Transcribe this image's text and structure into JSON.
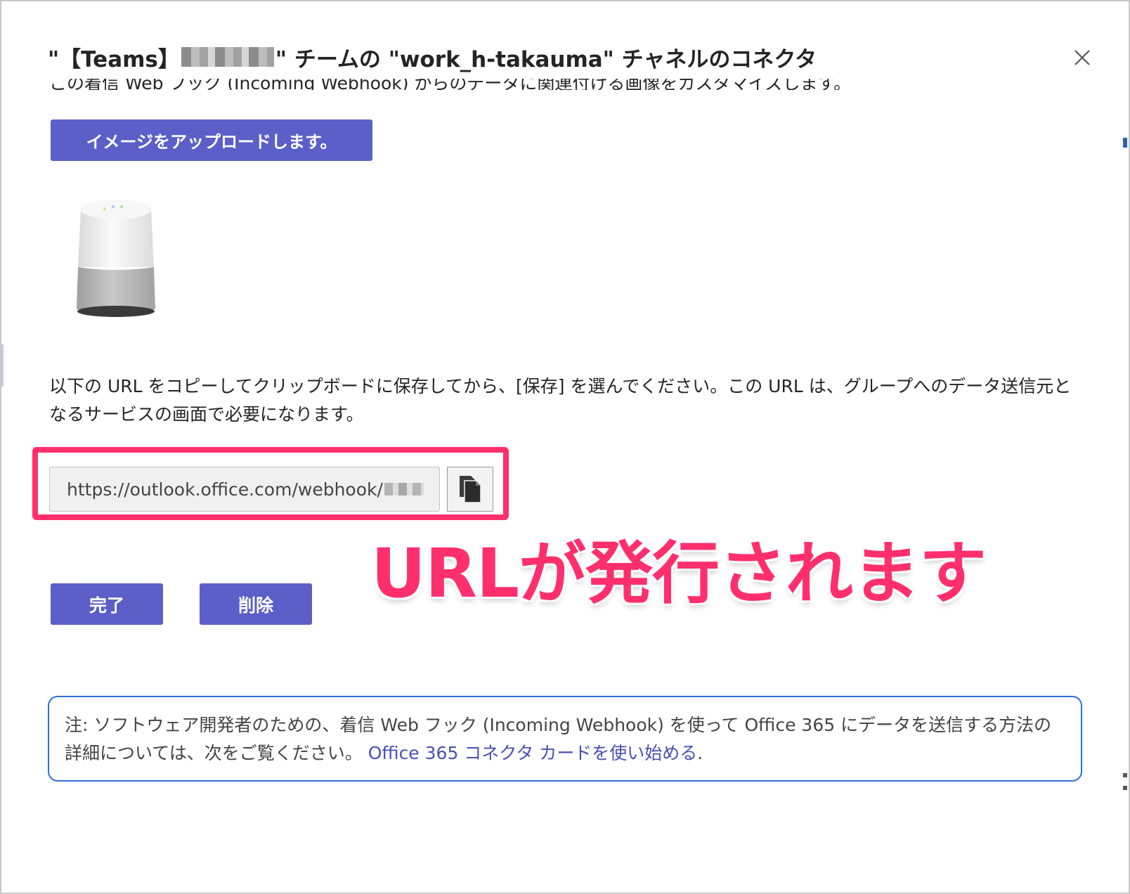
{
  "dialog": {
    "title_prefix": "\"【Teams】",
    "title_suffix": "\" チームの \"work_h-takauma\" チャネルのコネクタ",
    "close_icon": "close-icon",
    "partially_hidden_text": "この着信 Web フック (Incoming Webhook) からのデータに関連付ける画像をカスタマイズします。",
    "upload_button": "イメージをアップロードします。",
    "instruction": "以下の URL をコピーしてクリップボードに保存してから、[保存] を選んでください。この URL は、グループへのデータ送信元となるサービスの画面で必要になります。",
    "url_value": "https://outlook.office.com/webhook/",
    "copy_icon": "copy-icon",
    "done_button": "完了",
    "delete_button": "削除",
    "note_text": "注: ソフトウェア開発者のための、着信 Web フック (Incoming Webhook) を使って Office 365 にデータを送信する方法の詳細については、次をご覧ください。",
    "note_link": "Office 365 コネクタ カードを使い始める",
    "note_end": "."
  },
  "annotation": {
    "text": "URLが発行されます",
    "color": "#ff2f6e"
  },
  "colors": {
    "primary": "#5b5fc7",
    "highlight": "#ff2f6e",
    "note_border": "#2f6fd8"
  }
}
